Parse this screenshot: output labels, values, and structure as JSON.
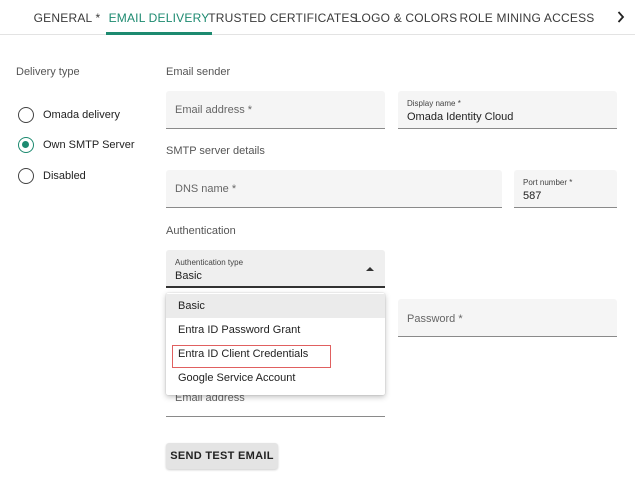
{
  "tabs": [
    {
      "label": "GENERAL *",
      "active": false
    },
    {
      "label": "EMAIL DELIVERY",
      "active": true
    },
    {
      "label": "TRUSTED CERTIFICATES",
      "active": false
    },
    {
      "label": "LOGO & COLORS",
      "active": false
    },
    {
      "label": "ROLE MINING ACCESS",
      "active": false
    }
  ],
  "accent_color": "#1d8a70",
  "tabs_scroll_icon": "chevron-right-icon",
  "delivery_type": {
    "label": "Delivery type",
    "options": [
      {
        "label": "Omada delivery",
        "checked": false
      },
      {
        "label": "Own SMTP Server",
        "checked": true
      },
      {
        "label": "Disabled",
        "checked": false
      }
    ]
  },
  "email_sender": {
    "label": "Email sender",
    "email_address": {
      "placeholder": "Email address *",
      "value": ""
    },
    "display_name": {
      "label": "Display name *",
      "value": "Omada Identity Cloud"
    }
  },
  "smtp": {
    "label": "SMTP server details",
    "dns_name": {
      "placeholder": "DNS name *",
      "value": ""
    },
    "port": {
      "label": "Port number *",
      "value": "587"
    }
  },
  "authentication": {
    "label": "Authentication",
    "type": {
      "label": "Authentication type",
      "value": "Basic"
    },
    "password": {
      "placeholder": "Password *"
    },
    "options": [
      {
        "label": "Basic",
        "selected": true
      },
      {
        "label": "Entra ID Password Grant",
        "selected": false
      },
      {
        "label": "Entra ID Client Credentials",
        "selected": false
      },
      {
        "label": "Google Service Account",
        "selected": false
      }
    ],
    "highlight_color": "#e06060"
  },
  "test": {
    "email_placeholder": "Email address",
    "send_button": "SEND TEST EMAIL"
  }
}
